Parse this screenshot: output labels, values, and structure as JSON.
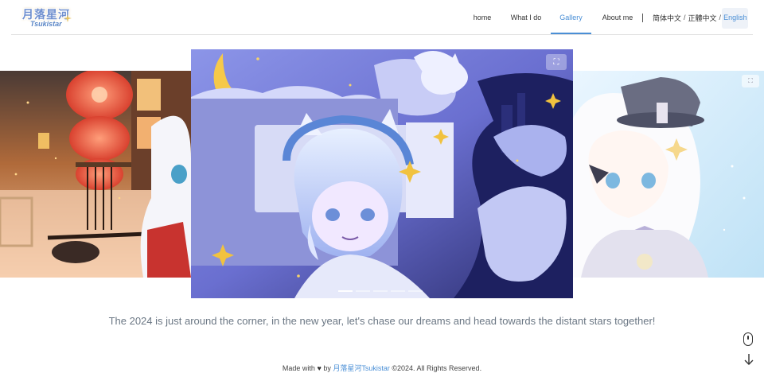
{
  "header": {
    "logo": {
      "main": "月落星河",
      "sub": "Tsukistar"
    },
    "nav": [
      {
        "label": "home",
        "active": false
      },
      {
        "label": "What I do",
        "active": false
      },
      {
        "label": "Gallery",
        "active": true
      },
      {
        "label": "About me",
        "active": false
      }
    ],
    "languages": [
      "简体中文",
      "正體中文",
      "English"
    ],
    "language_separator": "/"
  },
  "gallery": {
    "slides": [
      {
        "name": "lantern-girl-illustration"
      },
      {
        "name": "cat-boy-night-sky-illustration"
      },
      {
        "name": "white-hair-girl-hat-illustration"
      }
    ],
    "active_index": 1,
    "dot_count": 5,
    "active_dot": 0,
    "caption": "The 2024 is just around the corner, in the new year, let's chase our dreams and head towards the distant stars together!"
  },
  "footer": {
    "made_with": "Made with",
    "heart": "♥",
    "by": "by",
    "author": "月落星河Tsukistar",
    "copyright": "©2024. All Rights Reserved."
  },
  "icons": {
    "expand": "expand-icon",
    "mouse": "mouse-scroll-icon",
    "arrow": "arrow-down-icon"
  },
  "colors": {
    "accent": "#4a8fd6",
    "caption": "#6b7784",
    "divider": "#e2e2e2"
  }
}
